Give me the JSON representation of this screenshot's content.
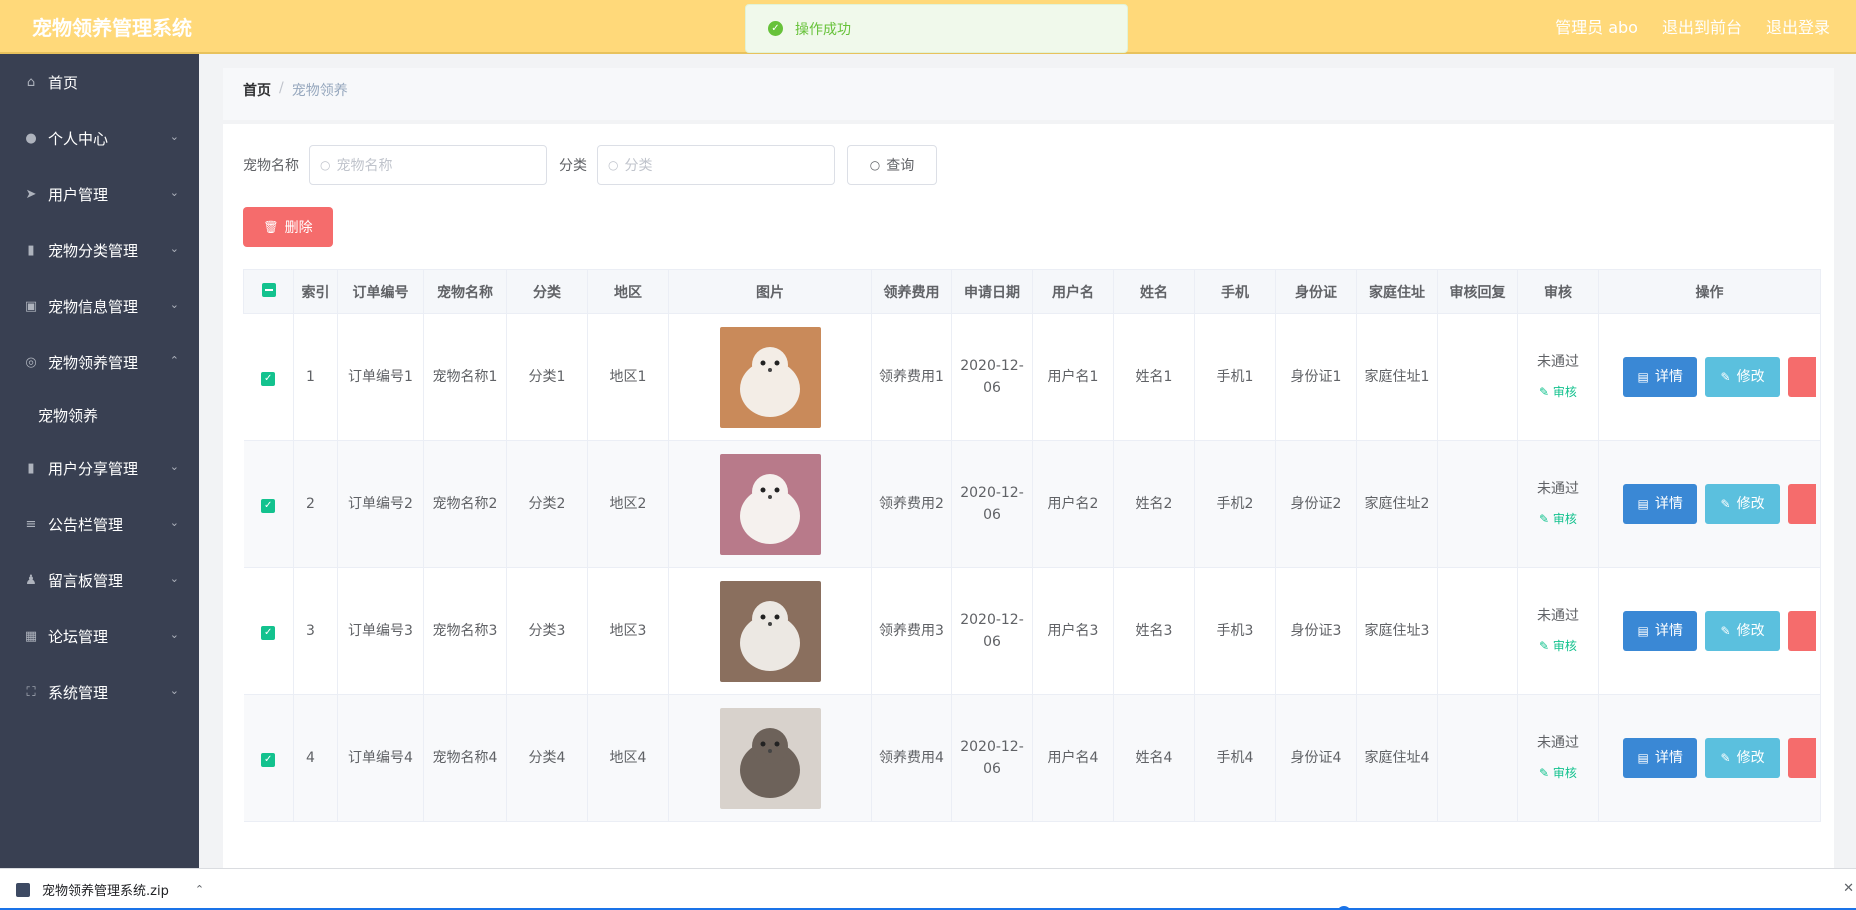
{
  "header": {
    "title": "宠物领养管理系统",
    "toast": "操作成功",
    "links": [
      "管理员 abo",
      "退出到前台",
      "退出登录"
    ]
  },
  "sidebar": {
    "items": [
      {
        "label": "首页",
        "icon": "home-icon"
      },
      {
        "label": "个人中心",
        "icon": "user-icon"
      },
      {
        "label": "用户管理",
        "icon": "send-icon"
      },
      {
        "label": "宠物分类管理",
        "icon": "chart-icon"
      },
      {
        "label": "宠物信息管理",
        "icon": "camera-icon"
      },
      {
        "label": "宠物领养管理",
        "icon": "target-icon"
      },
      {
        "label": "宠物领养",
        "icon": ""
      },
      {
        "label": "用户分享管理",
        "icon": "bar-icon"
      },
      {
        "label": "公告栏管理",
        "icon": "list-icon"
      },
      {
        "label": "留言板管理",
        "icon": "stamp-icon"
      },
      {
        "label": "论坛管理",
        "icon": "grid-icon"
      },
      {
        "label": "系统管理",
        "icon": "frame-icon"
      }
    ]
  },
  "breadcrumb": {
    "home": "首页",
    "sep": "/",
    "current": "宠物领养"
  },
  "search": {
    "name_label": "宠物名称",
    "name_placeholder": "宠物名称",
    "category_label": "分类",
    "category_placeholder": "分类",
    "query_label": "查询"
  },
  "delete_label": "删除",
  "table": {
    "headers": [
      "索引",
      "订单编号",
      "宠物名称",
      "分类",
      "地区",
      "图片",
      "领养费用",
      "申请日期",
      "用户名",
      "姓名",
      "手机",
      "身份证",
      "家庭住址",
      "审核回复",
      "审核",
      "操作"
    ],
    "rows": [
      {
        "index": "1",
        "order": "订单编号1",
        "name": "宠物名称1",
        "category": "分类1",
        "region": "地区1",
        "fee": "领养费用1",
        "date": "2020-12-06",
        "username": "用户名1",
        "realname": "姓名1",
        "phone": "手机1",
        "idcard": "身份证1",
        "address": "家庭住址1",
        "reply": "",
        "status": "未通过",
        "audit": "审核"
      },
      {
        "index": "2",
        "order": "订单编号2",
        "name": "宠物名称2",
        "category": "分类2",
        "region": "地区2",
        "fee": "领养费用2",
        "date": "2020-12-06",
        "username": "用户名2",
        "realname": "姓名2",
        "phone": "手机2",
        "idcard": "身份证2",
        "address": "家庭住址2",
        "reply": "",
        "status": "未通过",
        "audit": "审核"
      },
      {
        "index": "3",
        "order": "订单编号3",
        "name": "宠物名称3",
        "category": "分类3",
        "region": "地区3",
        "fee": "领养费用3",
        "date": "2020-12-06",
        "username": "用户名3",
        "realname": "姓名3",
        "phone": "手机3",
        "idcard": "身份证3",
        "address": "家庭住址3",
        "reply": "",
        "status": "未通过",
        "audit": "审核"
      },
      {
        "index": "4",
        "order": "订单编号4",
        "name": "宠物名称4",
        "category": "分类4",
        "region": "地区4",
        "fee": "领养费用4",
        "date": "2020-12-06",
        "username": "用户名4",
        "realname": "姓名4",
        "phone": "手机4",
        "idcard": "身份证4",
        "address": "家庭住址4",
        "reply": "",
        "status": "未通过",
        "audit": "审核"
      }
    ],
    "detail_label": "详情",
    "edit_label": "修改"
  },
  "download": {
    "filename": "宠物领养管理系统.zip"
  },
  "colors": {
    "header": "#ffd97a",
    "sidebar": "#394052",
    "accent": "#13c28e",
    "danger": "#f56c6c",
    "detail": "#3a88d5",
    "edit": "#5bc0de"
  }
}
